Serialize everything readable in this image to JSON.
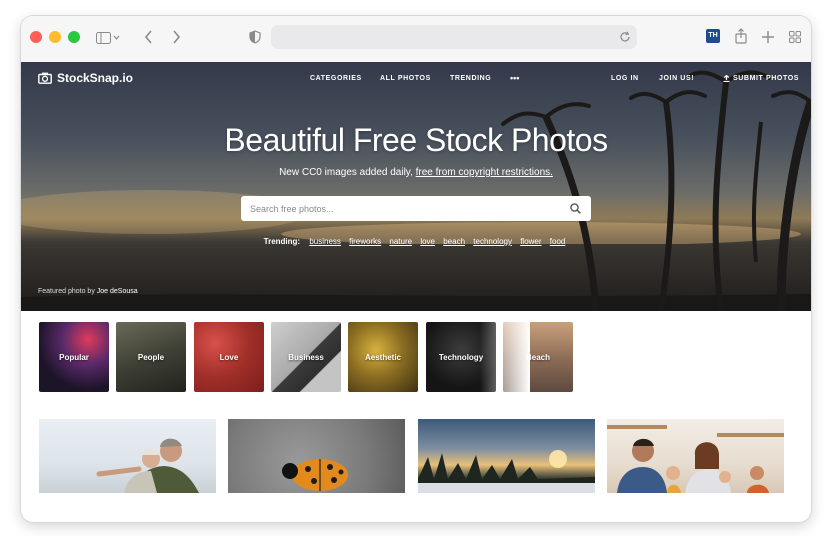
{
  "browser": {
    "url": "",
    "extension_badge": "TH"
  },
  "site": {
    "logo_text": "StockSnap.io",
    "nav": {
      "categories": "CATEGORIES",
      "all_photos": "ALL PHOTOS",
      "trending": "TRENDING",
      "more": "•••",
      "login": "LOG IN",
      "join": "JOIN US!",
      "submit": "SUBMIT PHOTOS"
    }
  },
  "hero": {
    "title": "Beautiful Free Stock Photos",
    "subtitle_pre": "New CC0 images added daily, ",
    "subtitle_link": "free from copyright restrictions.",
    "search_placeholder": "Search free photos...",
    "trending_label": "Trending:",
    "trending_terms": [
      "business",
      "fireworks",
      "nature",
      "love",
      "beach",
      "technology",
      "flower",
      "food"
    ],
    "credit_pre": "Featured photo by ",
    "credit_name": "Joe deSousa"
  },
  "categories": [
    {
      "label": "Popular",
      "color": "#2a1a3a"
    },
    {
      "label": "People",
      "color": "#4a4a40"
    },
    {
      "label": "Love",
      "color": "#a8322c"
    },
    {
      "label": "Business",
      "color": "#b7b7b7"
    },
    {
      "label": "Aesthetic",
      "color": "#6e5a20"
    },
    {
      "label": "Technology",
      "color": "#202020"
    },
    {
      "label": "Beach",
      "color": "#b98b68"
    }
  ],
  "photos": [
    {
      "subject": "elderly-couple"
    },
    {
      "subject": "ladybug"
    },
    {
      "subject": "sunset-forest"
    },
    {
      "subject": "family-kitchen"
    }
  ],
  "colors": {
    "close": "#fe5f57",
    "minimize": "#febc2e",
    "zoom": "#28c840"
  }
}
